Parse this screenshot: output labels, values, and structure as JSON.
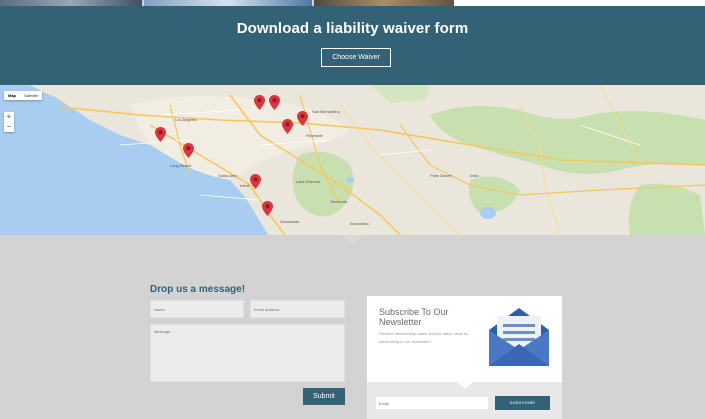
{
  "waiver": {
    "title": "Download a liability waiver form",
    "button_label": "Choose Waiver"
  },
  "map": {
    "type_controls": [
      "Map",
      "Satellite"
    ],
    "zoom_in": "+",
    "zoom_out": "−",
    "places": [
      "Los Angeles",
      "Long Beach",
      "Santa Ana",
      "Irvine",
      "San Bernardino",
      "Riverside",
      "Lake Elsinore",
      "Temecula",
      "Palm Desert",
      "Indio",
      "Oceanside",
      "Escondido"
    ],
    "pin_color": "#d9363e"
  },
  "contact": {
    "heading": "Drop us a message!",
    "name_placeholder": "Name",
    "email_placeholder": "Email address",
    "message_placeholder": "Message",
    "submit_label": "Submit"
  },
  "newsletter": {
    "title": "Subscribe To Our Newsletter",
    "text": "Receive membership deals and the latest news by subscribing to our newsletter!",
    "email_placeholder": "Email",
    "button_label": "SUBSCRIBE"
  },
  "colors": {
    "brand": "#336277",
    "background": "#d3d3d3"
  }
}
